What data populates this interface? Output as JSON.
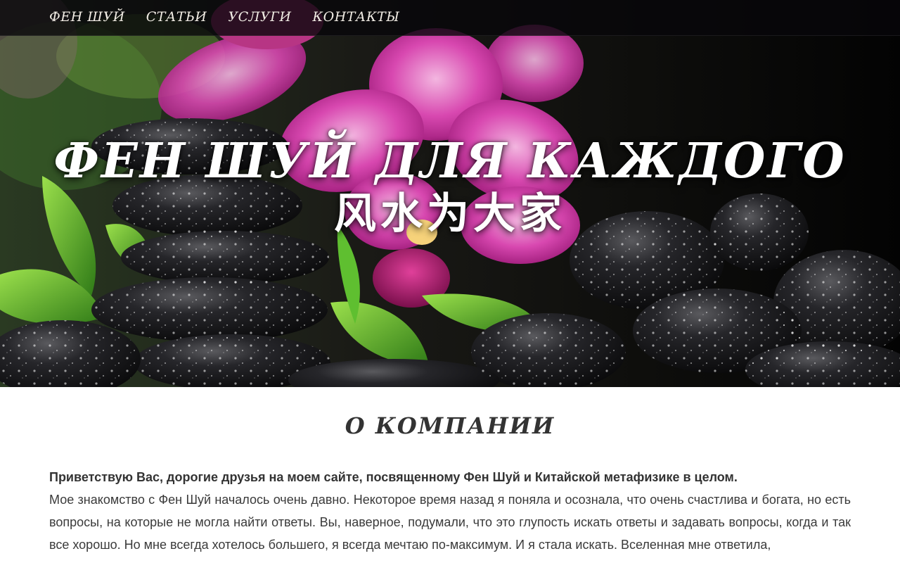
{
  "nav": {
    "items": [
      {
        "label": "ФЕН ШУЙ"
      },
      {
        "label": "СТАТЬИ"
      },
      {
        "label": "УСЛУГИ"
      },
      {
        "label": "КОНТАКТЫ"
      }
    ]
  },
  "hero": {
    "title": "ФЕН ШУЙ ДЛЯ КАЖДОГО",
    "subtitle": "风水为大家"
  },
  "about": {
    "heading": "О КОМПАНИИ",
    "lead": "Приветствую Вас, дорогие друзья на моем сайте, посвященному Фен Шуй и Китайской метафизике в целом.",
    "body": "Мое знакомство с Фен Шуй началось очень давно. Некоторое время назад я поняла и осознала, что очень счастлива и богата, но есть вопросы, на которые не могла найти ответы. Вы, наверное, подумали, что это глупость искать ответы и задавать вопросы, когда и так все хорошо. Но мне всегда хотелось большего, я всегда мечтаю по-максимум. И я стала искать. Вселенная мне ответила,"
  },
  "colors": {
    "nav_bg": "#08060a",
    "nav_text": "#f1ece4",
    "hero_text": "#ffffff",
    "heading": "#333333",
    "body": "#3a3a3a",
    "orchid": "#d63ca8",
    "leaf": "#4fae2a",
    "stone": "#1c1c1e"
  }
}
